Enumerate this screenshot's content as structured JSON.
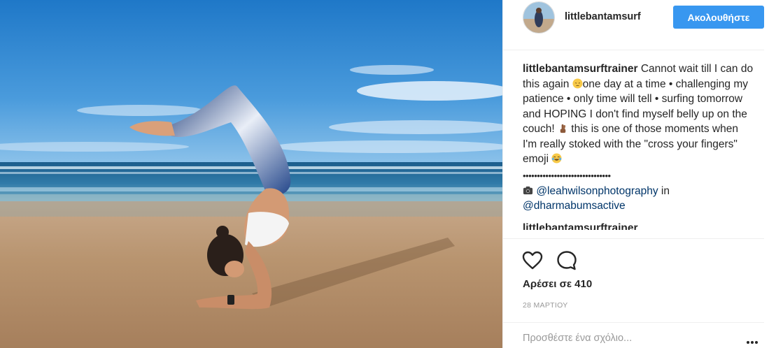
{
  "post": {
    "photo_alt": "photo",
    "username": "littlebantamsurf",
    "follow_label": "Ακολουθήστε",
    "caption": {
      "author": "littlebantamsurftrainer",
      "part1": " Cannot wait till I can do this again ",
      "part2": "one day at a time • challenging my patience • only time will tell • surfing tomorrow and HOPING I don't find myself belly up on the couch! ",
      "part3": " this is one of those moments when I'm really stoked with the \"cross your fingers\" emoji ",
      "dots": "•••••••••••••••••••••••••••••••",
      "camera_prefix": " ",
      "mention1": "@leahwilsonphotography",
      "in_text": " in ",
      "mention2": "@dharmabumsactive"
    },
    "next_comment_author": "littlebantamsurftrainer",
    "likes": "Αρέσει σε 410",
    "date": "28 ΜΑΡΤΙΟΥ",
    "comment_placeholder": "Προσθέστε ένα σχόλιο..."
  },
  "icons": {
    "like": "heart-outline-icon",
    "comment": "speech-bubble-icon",
    "more": "ellipsis-icon",
    "camera": "camera-icon"
  },
  "colors": {
    "follow_button": "#3897f0",
    "mention": "#003569",
    "muted": "#999999"
  }
}
